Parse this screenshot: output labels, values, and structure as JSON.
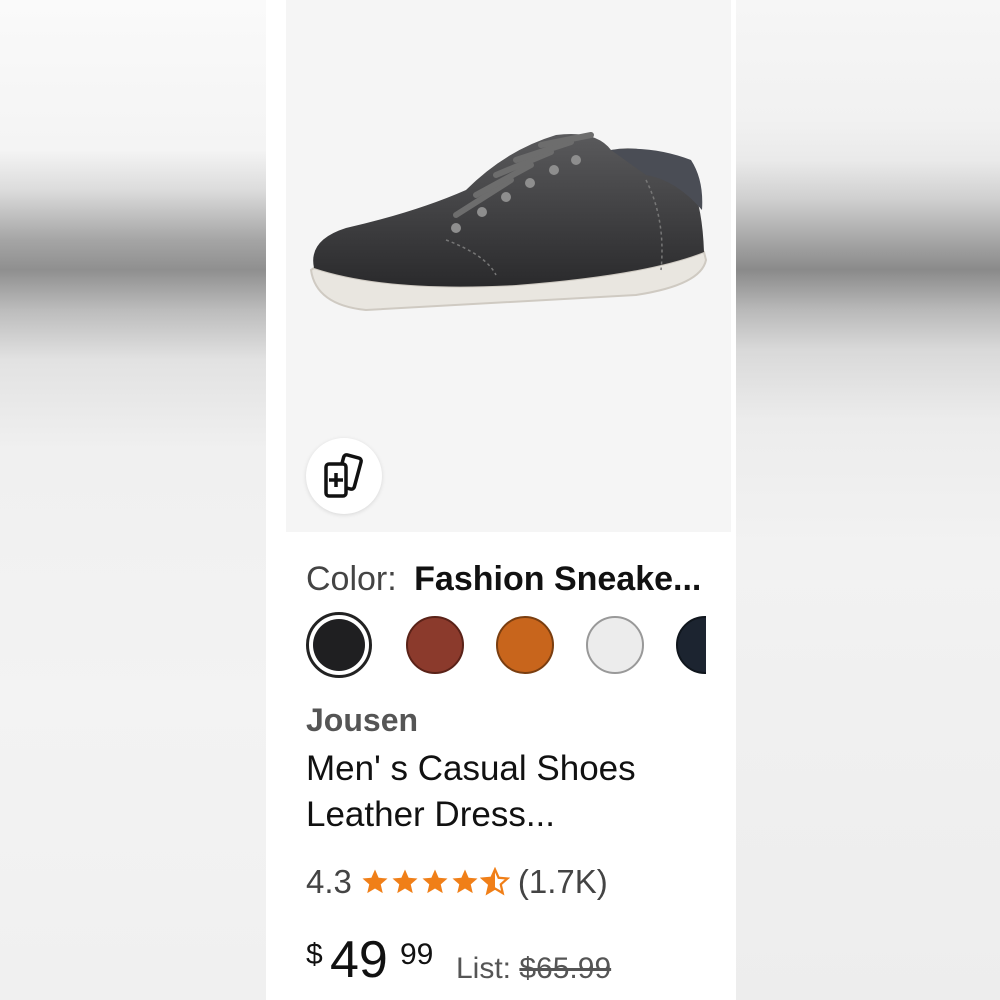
{
  "product": {
    "color_label": "Color:",
    "color_value": "Fashion Sneake...",
    "swatches": [
      {
        "name": "black",
        "color": "#1f1f21",
        "selected": true
      },
      {
        "name": "brown",
        "color": "#8b3a2c"
      },
      {
        "name": "tan",
        "color": "#c8651c"
      },
      {
        "name": "white",
        "color": "#ececec"
      },
      {
        "name": "navy",
        "color": "#1c2430"
      }
    ],
    "brand": "Jousen",
    "title_line1": "Men' s Casual Shoes",
    "title_line2": "Leather Dress...",
    "rating": "4.3",
    "review_count": "(1.7K)",
    "price_currency": "$",
    "price_whole": "49",
    "price_cents": "99",
    "list_label": "List:",
    "list_price": "$65.99",
    "compare_icon": "compare-cards-icon",
    "star_color": "#f07f18"
  }
}
